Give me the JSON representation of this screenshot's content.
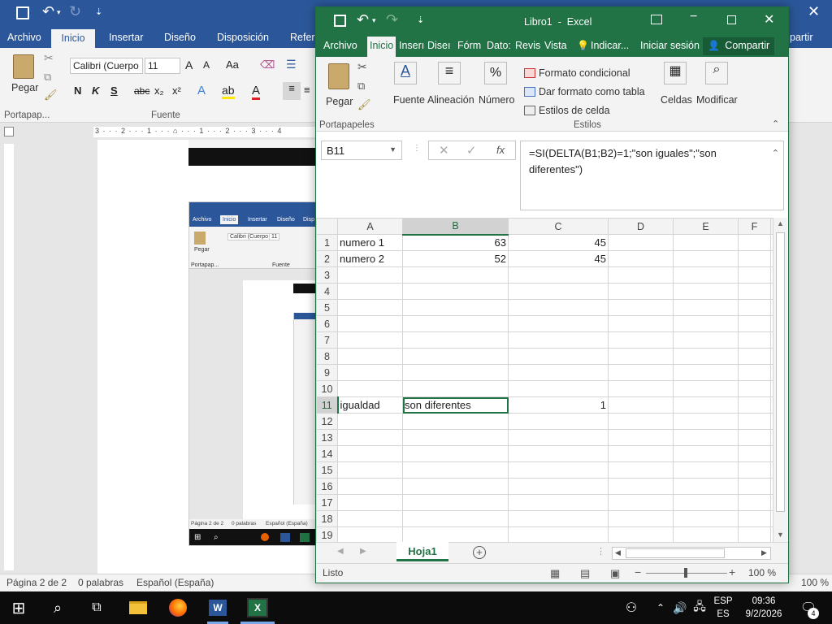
{
  "word": {
    "tabs": [
      "Archivo",
      "Inicio",
      "Insertar",
      "Diseño",
      "Disposición",
      "Refere"
    ],
    "active_tab": "Inicio",
    "ribbon": {
      "paste": "Pegar",
      "font_name": "Calibri (Cuerpo",
      "font_size": "11",
      "clipboard_group": "Portapap...",
      "font_group": "Fuente",
      "partir": "partir"
    },
    "status": {
      "page": "Página 2 de 2",
      "words": "0 palabras",
      "lang": "Español (España)",
      "zoom": "100 %"
    },
    "nested": {
      "tabs": [
        "Archivo",
        "Inicio",
        "Insertar",
        "Diseño",
        "Disp"
      ],
      "font": "Calibri (Cuerpo",
      "size": "11",
      "paste": "Pegar",
      "clip": "Portapap...",
      "font_group": "Fuente",
      "status": [
        "Página 2 de 2",
        "0 palabras",
        "Español (España)"
      ]
    },
    "top_strip_texts": [
      "Página 2 de 2",
      "0 palabras",
      "Español (España)"
    ]
  },
  "excel": {
    "title": "Libro1  -  Excel",
    "tabs": [
      "Archivo",
      "Inicio",
      "Inserı",
      "Diseı",
      "Fórm",
      "Dato:",
      "Revis",
      "Vista",
      "Indicar...",
      "Iniciar sesión",
      "Compartir"
    ],
    "ribbon": {
      "pegar": "Pegar",
      "fuente": "Fuente",
      "alineacion": "Alineación",
      "numero": "Número",
      "formato_condicional": "Formato condicional",
      "dar_formato": "Dar formato como tabla",
      "estilos_celda": "Estilos de celda",
      "celdas": "Celdas",
      "modificar": "Modificar",
      "portapapeles": "Portapapeles",
      "estilos": "Estilos"
    },
    "name_box": "B11",
    "formula": "=SI(DELTA(B1;B2)=1;\"son iguales\";\"son diferentes\")",
    "columns": [
      "A",
      "B",
      "C",
      "D",
      "E",
      "F"
    ],
    "rows": [
      {
        "n": "1",
        "A": "numero 1",
        "B": "63",
        "C": "45"
      },
      {
        "n": "2",
        "A": "numero 2",
        "B": "52",
        "C": "45"
      },
      {
        "n": "3"
      },
      {
        "n": "4"
      },
      {
        "n": "5"
      },
      {
        "n": "6"
      },
      {
        "n": "7"
      },
      {
        "n": "8"
      },
      {
        "n": "9"
      },
      {
        "n": "10"
      },
      {
        "n": "11",
        "A": "igualdad",
        "B": "son diferentes",
        "C": "1"
      },
      {
        "n": "12"
      },
      {
        "n": "13"
      },
      {
        "n": "14"
      },
      {
        "n": "15"
      },
      {
        "n": "16"
      },
      {
        "n": "17"
      },
      {
        "n": "18"
      },
      {
        "n": "19"
      }
    ],
    "active_cell": "B11",
    "sheet_tab": "Hoja1",
    "status": "Listo",
    "zoom": "100 %"
  },
  "taskbar": {
    "lang1": "ESP",
    "lang2": "ES",
    "time": "09:36",
    "date": "9/2/2026",
    "notif_count": "4"
  },
  "colors": {
    "word_blue": "#2b579a",
    "excel_green": "#217346",
    "taskbar": "#0c0c0c"
  }
}
